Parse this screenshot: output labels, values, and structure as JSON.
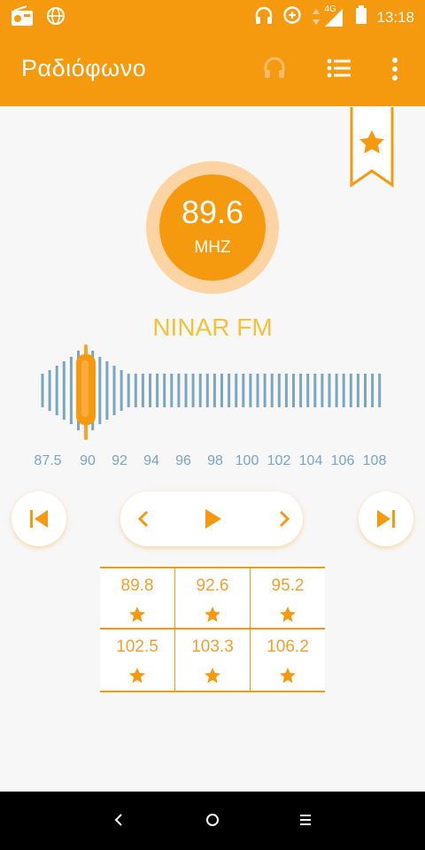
{
  "status_bar": {
    "time": "13:18",
    "network": "4G",
    "icons": [
      "radio-icon",
      "globe-icon",
      "headphones-icon",
      "data-saver-icon",
      "signal-icon",
      "battery-icon"
    ]
  },
  "app_bar": {
    "title": "Ραδιόφωνο",
    "icons": [
      "headphones-icon",
      "list-icon",
      "more-vert-icon"
    ]
  },
  "tuner": {
    "frequency": "89.6",
    "unit": "MHZ",
    "station_name": "NINAR FM",
    "scale_labels": [
      "87.5",
      "90",
      "92",
      "94",
      "96",
      "98",
      "100",
      "102",
      "104",
      "106",
      "108"
    ]
  },
  "controls": {
    "icons": [
      "skip-previous-icon",
      "chevron-left-icon",
      "play-icon",
      "chevron-right-icon",
      "skip-next-icon"
    ]
  },
  "presets": [
    {
      "freq": "89.8"
    },
    {
      "freq": "92.6"
    },
    {
      "freq": "95.2"
    },
    {
      "freq": "102.5"
    },
    {
      "freq": "103.3"
    },
    {
      "freq": "106.2"
    }
  ],
  "nav_bar": {
    "icons": [
      "back-icon",
      "home-icon",
      "recents-icon"
    ]
  },
  "colors": {
    "accent": "#f5990f",
    "dial_ring": "#fcd4a4",
    "station_text": "#f5c137",
    "scale_bars": "#7aa6bf"
  }
}
